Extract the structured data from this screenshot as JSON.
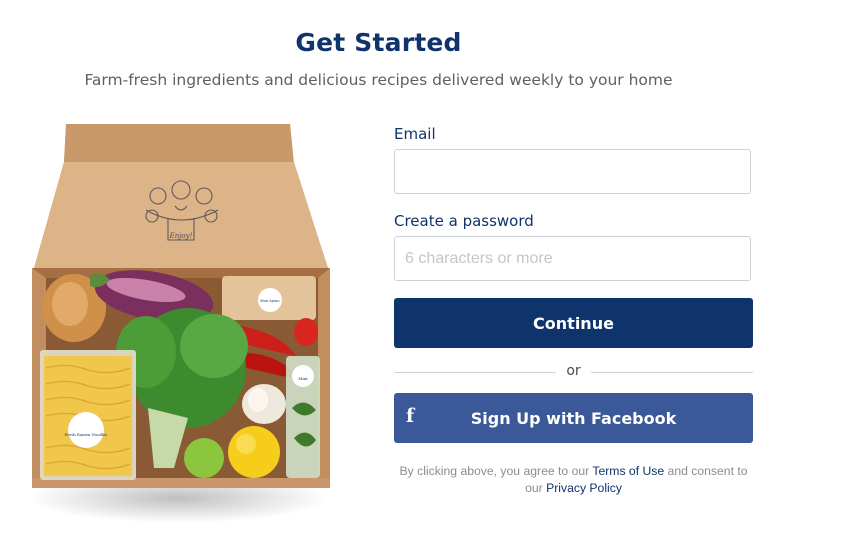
{
  "header": {
    "title": "Get Started",
    "subtitle": "Farm-fresh ingredients and delicious recipes delivered weekly to your home"
  },
  "illustration": {
    "lid_text": "Enjoy!",
    "package_labels": [
      "Blue Apron",
      "Blue Apron",
      "Blue Apron",
      "Blue Apron"
    ],
    "noodle_label": "Fresh Ramen Noodles",
    "herb_label": "Mint"
  },
  "form": {
    "email_label": "Email",
    "email_value": "",
    "password_label": "Create a password",
    "password_placeholder": "6 characters or more",
    "continue_label": "Continue",
    "divider_text": "or",
    "facebook_label": "Sign Up with Facebook",
    "facebook_icon": "f"
  },
  "legal": {
    "prefix": "By clicking above, you agree to our ",
    "terms_link": "Terms of Use",
    "middle": " and consent to our ",
    "privacy_link": "Privacy Policy"
  },
  "colors": {
    "brand_navy": "#0f346c",
    "facebook_blue": "#3b5998",
    "cardboard": "#d2a679"
  },
  "icons": {
    "facebook": "facebook-icon"
  }
}
